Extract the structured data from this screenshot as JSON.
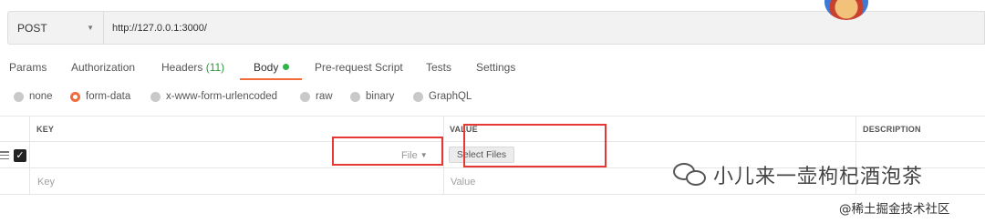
{
  "request": {
    "method": "POST",
    "url": "http://127.0.0.1:3000/"
  },
  "tabs": [
    {
      "label": "Params"
    },
    {
      "label": "Authorization"
    },
    {
      "label": "Headers",
      "count": "(11)"
    },
    {
      "label": "Body",
      "active": true
    },
    {
      "label": "Pre-request Script"
    },
    {
      "label": "Tests"
    },
    {
      "label": "Settings"
    }
  ],
  "body_types": [
    {
      "label": "none",
      "selected": false
    },
    {
      "label": "form-data",
      "selected": true
    },
    {
      "label": "x-www-form-urlencoded",
      "selected": false
    },
    {
      "label": "raw",
      "selected": false
    },
    {
      "label": "binary",
      "selected": false
    },
    {
      "label": "GraphQL",
      "selected": false
    }
  ],
  "table": {
    "headers": {
      "key": "KEY",
      "value": "VALUE",
      "description": "DESCRIPTION"
    },
    "row1": {
      "checked": true,
      "type_select": "File",
      "select_files_label": "Select Files"
    },
    "new_row": {
      "key_placeholder": "Key",
      "value_placeholder": "Value"
    }
  },
  "watermark": {
    "main": "小儿来一壶枸杞酒泡茶",
    "sub": "@稀土掘金技术社区"
  },
  "colors": {
    "accent": "#f26b3a",
    "active_dot": "#2fb34a",
    "headers_count": "#2d9a3e",
    "highlight": "#e53935"
  }
}
